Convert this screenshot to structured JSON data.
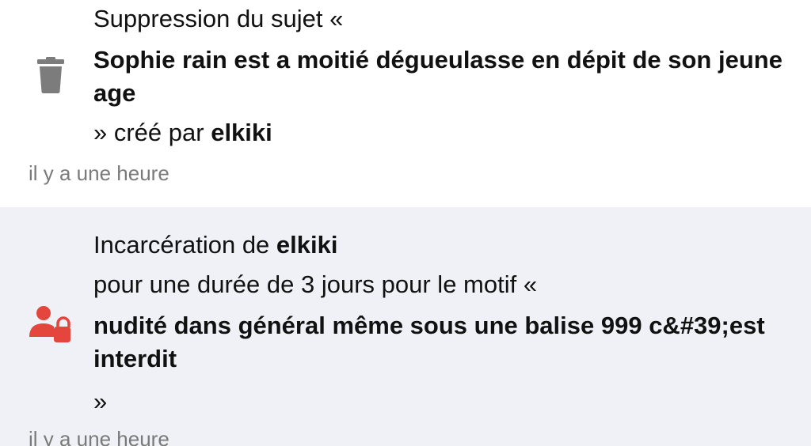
{
  "colors": {
    "entry_bg_primary": "#ffffff",
    "entry_bg_secondary": "#eff1f6",
    "trash_icon": "#7c7c7c",
    "sanction_icon": "#e4453c",
    "timestamp": "#7a7a7a"
  },
  "entries": [
    {
      "icon": "trash-icon",
      "intro": "Suppression du sujet «",
      "title": "Sophie rain est a moitié dégueulasse en dépit de son jeune age",
      "closing_prefix": "» créé par ",
      "author": "elkiki",
      "time": "il y a une heure"
    },
    {
      "icon": "user-lock-icon",
      "action": "Incarcération de ",
      "user": "elkiki",
      "detail": "pour une durée de 3 jours pour le motif «",
      "reason": "nudité dans général même sous une balise 999 c&#39;est interdit",
      "closing": "»",
      "time": "il y a une heure"
    }
  ]
}
